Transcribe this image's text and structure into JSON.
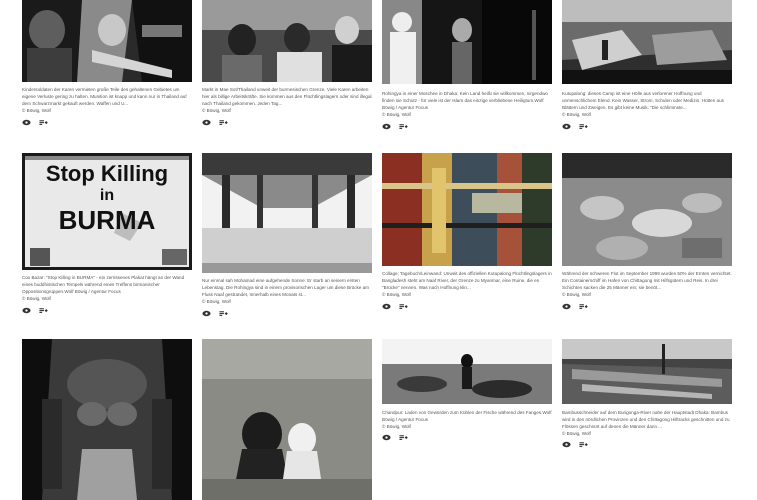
{
  "cards": [
    {
      "caption": "Kindersoldaten der Karen vermieten große Teile des gehaltenen Gebietes um eigene Verluste gering zu halten. Munition ist knapp und kann nur in Thailand auf dem Schwarzmarkt gekauft werden. Waffen und U...",
      "credit": "© Böwig, Wolf",
      "view_icon": "eye-icon",
      "add_icon": "add-to-lightbox-icon"
    },
    {
      "caption": "Markt in Mae Sot/Thailand unweit der burmesischen Grenze. Viele Karen arbeiten hier als billige Arbeitskräfte. Sie kommen aus den Flüchtlingslagern oder sind illegal nach Thailand gekommen. Jeden Tag...",
      "credit": "© Böwig, Wolf",
      "view_icon": "eye-icon",
      "add_icon": "add-to-lightbox-icon"
    },
    {
      "caption": "Rohingya in einer Moschee in Dhaka: Kein Land heißt sie willkommen, nirgendwo finden sie Schutz - für viele ist der Islam das einzige verbliebene Heiligtum.Wolf Böwig / Agentur Focus",
      "credit": "© Böwig, Wolf",
      "view_icon": "eye-icon",
      "add_icon": "add-to-lightbox-icon"
    },
    {
      "caption": "Kutupalong: dieses Camp ist eine Hölle aus verlorener Hoffnung und unmenschlichem Elend. Kein Wasser, Strom, Schulen oder Medizin. Hütten aus Blättern und Zweigen. Es gibt keine Musik. \"Die schlimmste...",
      "credit": "© Böwig, Wolf",
      "view_icon": "eye-icon",
      "add_icon": "add-to-lightbox-icon"
    },
    {
      "caption": "Cox Bazar: \"Stop Killing in BURMA\" - ein zerrissenes Plakat hängt an der Wand eines buddhistischen Tempels während eines Treffens birmanischer Oppositionsgruppen.Wolf Böwig / Agentur Focus",
      "credit": "© Böwig, Wolf",
      "view_icon": "eye-icon",
      "add_icon": "add-to-lightbox-icon",
      "sign_top": "Stop Killing",
      "sign_mid": "in",
      "sign_bottom": "BURMA"
    },
    {
      "caption": "Nur einmal sah Mohamad eine aufgehende Sonne: Er starb an seinem ersten Lebenstag. Die Rohingya sind in einem provisorischen Lager um diese Brücke am Fluss Naaf gestrandet, Innerhalb eines Monats st...",
      "credit": "© Böwig, Wolf",
      "view_icon": "eye-icon",
      "add_icon": "add-to-lightbox-icon"
    },
    {
      "caption": "Collage; Tagebuch/Leinwand: Unweit des offiziellen Kutupalong Flüchtlingslagers in Bangladesh steht am Naaf River, der Grenze zu Myanmar, eine Ruine, die en \"Brücke\" nennen. Was nach Hoffnung klin...",
      "credit": "© Böwig, Wolf",
      "view_icon": "eye-icon",
      "add_icon": "add-to-lightbox-icon"
    },
    {
      "caption": "Während der schweren Flut im September 1999 wurden 50% der Ernten vernichtet. Ein Containerschiff im Hafen von Chittagong mit Hilfsgütern und Reis. In drei Schichten sacken die 25 Männer ein; sie benöt...",
      "credit": "© Böwig, Wolf",
      "view_icon": "eye-icon",
      "add_icon": "add-to-lightbox-icon"
    },
    {
      "caption": "",
      "credit": "",
      "view_icon": "eye-icon",
      "add_icon": "add-to-lightbox-icon"
    },
    {
      "caption": "",
      "credit": "",
      "view_icon": "eye-icon",
      "add_icon": "add-to-lightbox-icon"
    },
    {
      "caption": "Chandpur: Laden von Gewürden zum Kühlen der Fische während des Fanges.Wolf Böwig / Agentur Focus",
      "credit": "© Böwig, Wolf",
      "view_icon": "eye-icon",
      "add_icon": "add-to-lightbox-icon"
    },
    {
      "caption": "Bambusschneider auf dem Burigonga-River nahe der Hauptstadt Dhaka: Bambus wird in den nördlichen Provinzen und den Chittagong Hilltracks geschnitten und zu Flössen geschnürt auf denen die Männer dann ...",
      "credit": "© Böwig, Wolf",
      "view_icon": "eye-icon",
      "add_icon": "add-to-lightbox-icon"
    }
  ]
}
